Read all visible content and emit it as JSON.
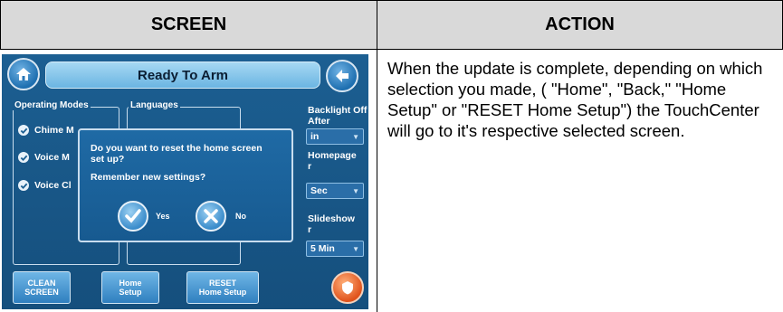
{
  "table": {
    "header_screen": "SCREEN",
    "header_action": "ACTION",
    "action_text": "When the update is complete, depending on which selection you made, ( \"Home\", \"Back,\" \"Home Setup\" or \"RESET Home Setup\") the TouchCenter will go to it's respective selected screen."
  },
  "device": {
    "title": "Ready To Arm",
    "operating_modes_label": "Operating Modes",
    "languages_label": "Languages",
    "modes": [
      {
        "label": "Chime M"
      },
      {
        "label": "Voice M"
      },
      {
        "label": "Voice Cl"
      }
    ],
    "right_panel": {
      "backlight_label_1": "Backlight Off",
      "backlight_label_2": "After",
      "backlight_value": "in",
      "homepage_label_1": "Homepage",
      "homepage_label_2": "r",
      "homepage_value": "Sec",
      "slideshow_label_1": "Slideshow",
      "slideshow_label_2": "r",
      "slideshow_value": "5 Min"
    },
    "dialog": {
      "question": "Do you want to reset the home screen set up?",
      "remember": "Remember new settings?",
      "yes_label": "Yes",
      "no_label": "No"
    },
    "buttons": {
      "clean_1": "CLEAN",
      "clean_2": "SCREEN",
      "home_setup_1": "Home",
      "home_setup_2": "Setup",
      "reset_1": "RESET",
      "reset_2": "Home Setup"
    },
    "colors": {
      "panel_blue": "#1c5f92",
      "title_bar": "#8ec9ed",
      "emergency": "#e0531c"
    }
  }
}
